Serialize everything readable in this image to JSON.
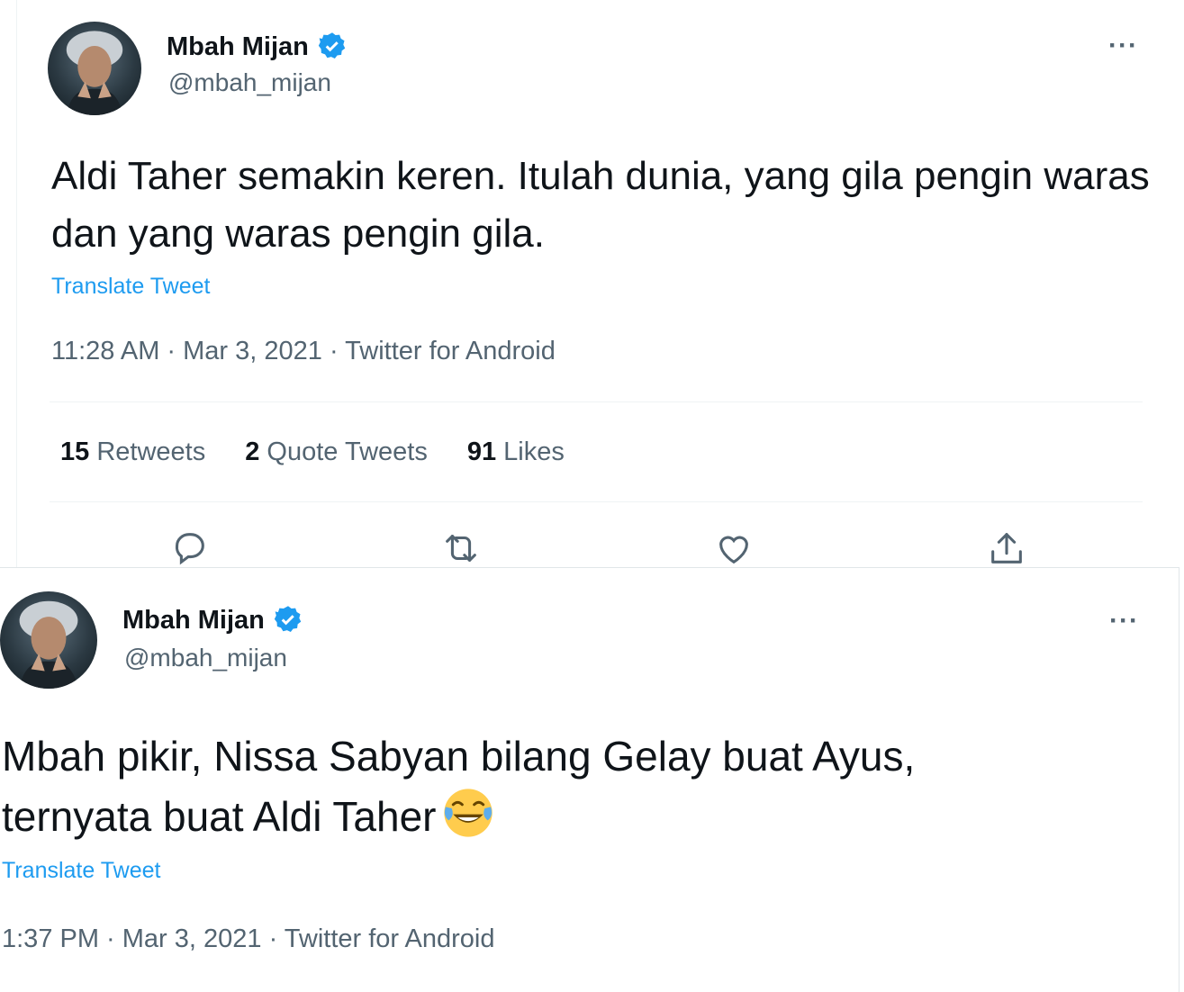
{
  "tweets": [
    {
      "author_name": "Mbah Mijan",
      "handle": "@mbah_mijan",
      "more_label": "···",
      "text": "Aldi Taher semakin keren. Itulah dunia, yang gila pengin waras dan yang waras pengin gila.",
      "translate_label": "Translate Tweet",
      "meta": "11:28 AM · Mar 3, 2021 · Twitter for Android",
      "stats": {
        "retweets_count": "15",
        "retweets_label": "Retweets",
        "quotes_count": "2",
        "quotes_label": "Quote Tweets",
        "likes_count": "91",
        "likes_label": "Likes"
      },
      "actions": [
        "reply-icon",
        "retweet-icon",
        "like-icon",
        "share-icon"
      ]
    },
    {
      "author_name": "Mbah Mijan",
      "handle": "@mbah_mijan",
      "more_label": "···",
      "text_line1": "Mbah pikir, Nissa Sabyan bilang Gelay buat Ayus,",
      "text_line2": "ternyata buat Aldi Taher",
      "emoji": "face-with-tears-of-joy",
      "translate_label": "Translate Tweet",
      "meta": "1:37 PM · Mar 3, 2021 · Twitter for Android"
    }
  ],
  "colors": {
    "accent": "#1d9bf0",
    "text": "#0f1419",
    "secondary": "#536471",
    "divider": "#eff3f4"
  }
}
